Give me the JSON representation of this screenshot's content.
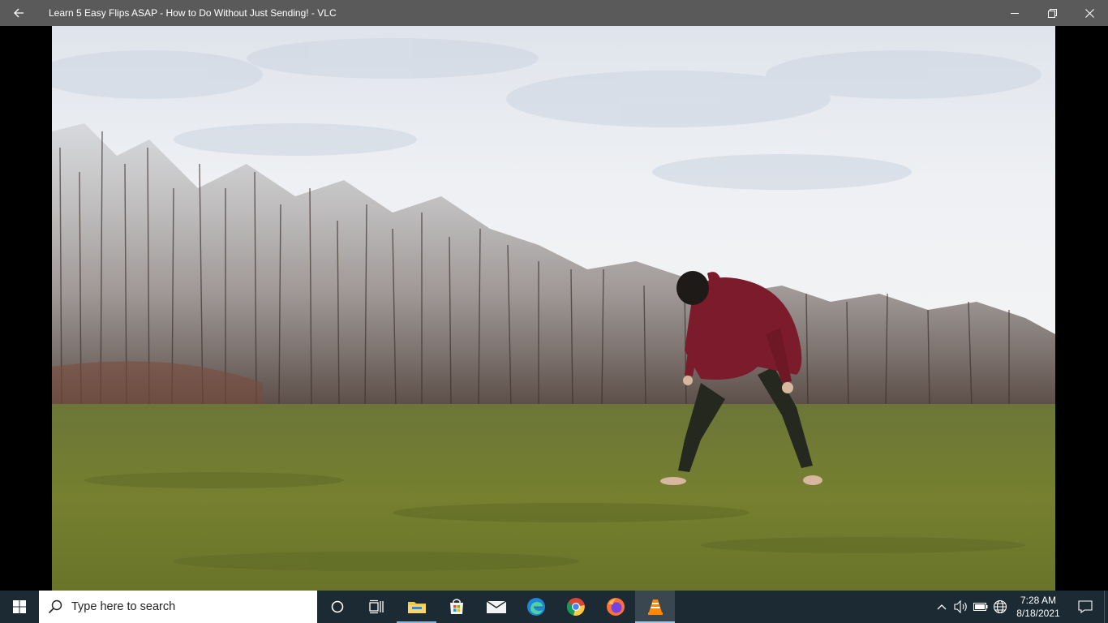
{
  "window": {
    "title": "Learn 5 Easy Flips ASAP - How to Do Without Just Sending! - VLC",
    "back_icon": "back-arrow-icon",
    "controls": [
      "minimize-icon",
      "restore-icon",
      "close-icon"
    ]
  },
  "video": {
    "scene": "video-frame"
  },
  "taskbar": {
    "search_placeholder": "Type here to search",
    "pinned": [
      {
        "name": "cortana-icon"
      },
      {
        "name": "task-view-icon"
      },
      {
        "name": "file-explorer-icon"
      },
      {
        "name": "microsoft-store-icon"
      },
      {
        "name": "mail-icon"
      },
      {
        "name": "edge-icon"
      },
      {
        "name": "chrome-icon"
      },
      {
        "name": "firefox-icon"
      },
      {
        "name": "vlc-icon"
      }
    ],
    "tray": {
      "time": "7:28 AM",
      "date": "8/18/2021"
    }
  },
  "colors": {
    "titlebar": "#5a5a5a",
    "taskbar": "#1c2a33",
    "sky": "#e6e9ee",
    "grass": "#6f7a35",
    "hoodie": "#7a1c2a"
  }
}
